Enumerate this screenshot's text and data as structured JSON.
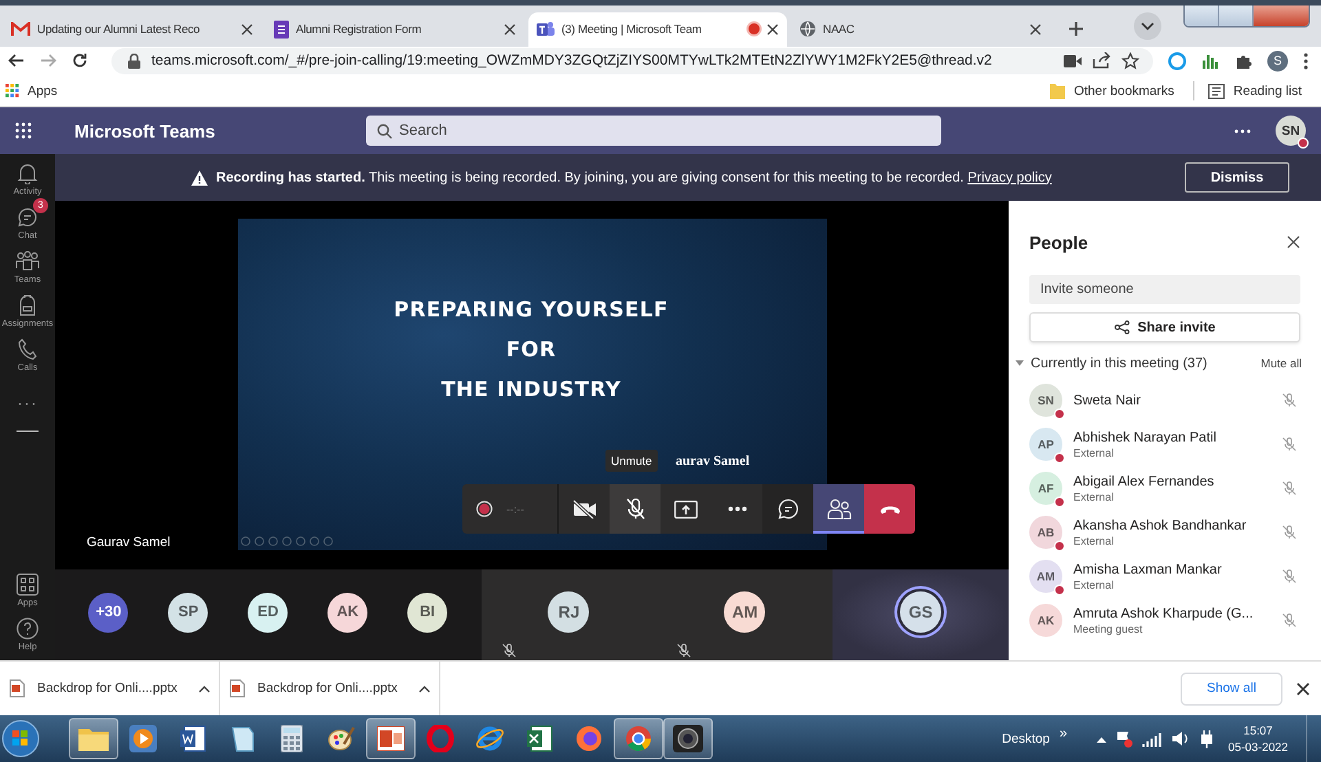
{
  "browser": {
    "tabs": [
      {
        "kind": "mail",
        "title": "Updating our Alumni Latest Reco",
        "selected": false,
        "recording": false
      },
      {
        "kind": "form",
        "title": "Alumni Registration Form",
        "selected": false,
        "recording": false
      },
      {
        "kind": "teams",
        "title": "(3) Meeting | Microsoft Team",
        "selected": true,
        "recording": true
      },
      {
        "kind": "globe",
        "title": "NAAC",
        "selected": false,
        "recording": false
      }
    ],
    "address": "teams.microsoft.com/_#/pre-join-calling/19:meeting_OWZmMDY3ZGQtZjZIYS00MTYwLTk2MTEtN2ZlYWY1M2FkY2E5@thread.v2",
    "profile_initial": "S",
    "bookmarks": {
      "apps": "Apps",
      "other": "Other bookmarks",
      "reading_list": "Reading list"
    }
  },
  "teams": {
    "app_name": "Microsoft Teams",
    "search_placeholder": "Search",
    "user_initials": "SN",
    "user_busy": true
  },
  "rail": {
    "top": [
      {
        "kind": "activity",
        "label": "Activity"
      },
      {
        "kind": "chat",
        "label": "Chat",
        "badge": "3"
      },
      {
        "kind": "teams",
        "label": "Teams"
      },
      {
        "kind": "assignments",
        "label": "Assignments"
      },
      {
        "kind": "calls",
        "label": "Calls"
      }
    ],
    "more": "···",
    "bottom": [
      {
        "kind": "apps",
        "label": "Apps"
      },
      {
        "kind": "help",
        "label": "Help"
      }
    ]
  },
  "banner": {
    "text": "**Recording has started.** This meeting is being recorded. By joining, you are giving consent for this meeting to be recorded.",
    "link": "Privacy policy",
    "button": "Dismiss"
  },
  "stage": {
    "presenter": "Gaurav Samel",
    "slide_lines": [
      "PREPARING YOURSELF",
      "FOR",
      "THE INDUSTRY"
    ],
    "slide_caption": "aurav Samel",
    "timer": "--:--",
    "tooltip": "Unmute",
    "controls": [
      {
        "kind": "camera-off",
        "selected": false,
        "hovered": false
      },
      {
        "kind": "mic-off",
        "selected": false,
        "hovered": true
      },
      {
        "kind": "share",
        "selected": false,
        "hovered": false
      },
      {
        "kind": "more",
        "selected": false,
        "hovered": false
      },
      {
        "kind": "chat",
        "selected": false,
        "hovered": false
      },
      {
        "kind": "people",
        "selected": true,
        "hovered": false
      },
      {
        "kind": "hang-up",
        "selected": false,
        "hovered": false
      }
    ]
  },
  "participants": {
    "overflow": "+30",
    "avatars": [
      {
        "initials": "SP",
        "color": "#d3e2e6"
      },
      {
        "initials": "ED",
        "color": "#d8f1f1"
      },
      {
        "initials": "AK",
        "color": "#f6d7d9"
      },
      {
        "initials": "BI",
        "color": "#e0e6d4"
      }
    ],
    "tiles": [
      {
        "initials": "RJ",
        "color": "#d3dfe3",
        "muted": true,
        "speaking": false
      },
      {
        "initials": "AM",
        "color": "#f8dbd3",
        "muted": true,
        "speaking": false
      },
      {
        "initials": "GS",
        "color": "#d5e0ea",
        "muted": false,
        "speaking": true
      }
    ]
  },
  "people": {
    "title": "People",
    "invite_placeholder": "Invite someone",
    "share_button": "Share invite",
    "section": "Currently in this meeting (37)",
    "expanded": true,
    "mute_all": "Mute all",
    "list": [
      {
        "initials": "SN",
        "name": "Sweta Nair",
        "color": "#dfe4dc",
        "busy": true,
        "muted": true
      },
      {
        "initials": "AP",
        "name": "Abhishek Narayan Patil",
        "subtitle": "External",
        "color": "#d8e8f1",
        "busy": true,
        "muted": true
      },
      {
        "initials": "AF",
        "name": "Abigail Alex Fernandes",
        "subtitle": "External",
        "color": "#d6efe0",
        "busy": true,
        "muted": true
      },
      {
        "initials": "AB",
        "name": "Akansha Ashok Bandhankar",
        "subtitle": "External",
        "color": "#f1d7dc",
        "busy": true,
        "muted": true
      },
      {
        "initials": "AM",
        "name": "Amisha Laxman Mankar",
        "subtitle": "External",
        "color": "#e3dff1",
        "busy": true,
        "muted": true
      },
      {
        "initials": "AK",
        "name": "Amruta Ashok Kharpude (G...",
        "subtitle": "Meeting guest",
        "color": "#f6d9d9",
        "busy": false,
        "muted": true
      }
    ]
  },
  "downloads": {
    "items": [
      "Backdrop for Onli....pptx",
      "Backdrop for Onli....pptx"
    ],
    "show_all": "Show all"
  },
  "taskbar": {
    "apps": [
      {
        "kind": "folder",
        "open": true
      },
      {
        "kind": "media",
        "open": false
      },
      {
        "kind": "word",
        "open": false
      },
      {
        "kind": "notepad",
        "open": false
      },
      {
        "kind": "calculator",
        "open": false
      },
      {
        "kind": "paint",
        "open": false
      },
      {
        "kind": "powerpoint",
        "open": true
      },
      {
        "kind": "opera",
        "open": false
      },
      {
        "kind": "ie",
        "open": false
      },
      {
        "kind": "excel",
        "open": false
      },
      {
        "kind": "firefox",
        "open": false
      },
      {
        "kind": "chrome",
        "open": true
      },
      {
        "kind": "camera",
        "open": true
      }
    ],
    "desktop": "Desktop",
    "overflow": "»",
    "time": "15:07",
    "date": "05-03-2022"
  }
}
